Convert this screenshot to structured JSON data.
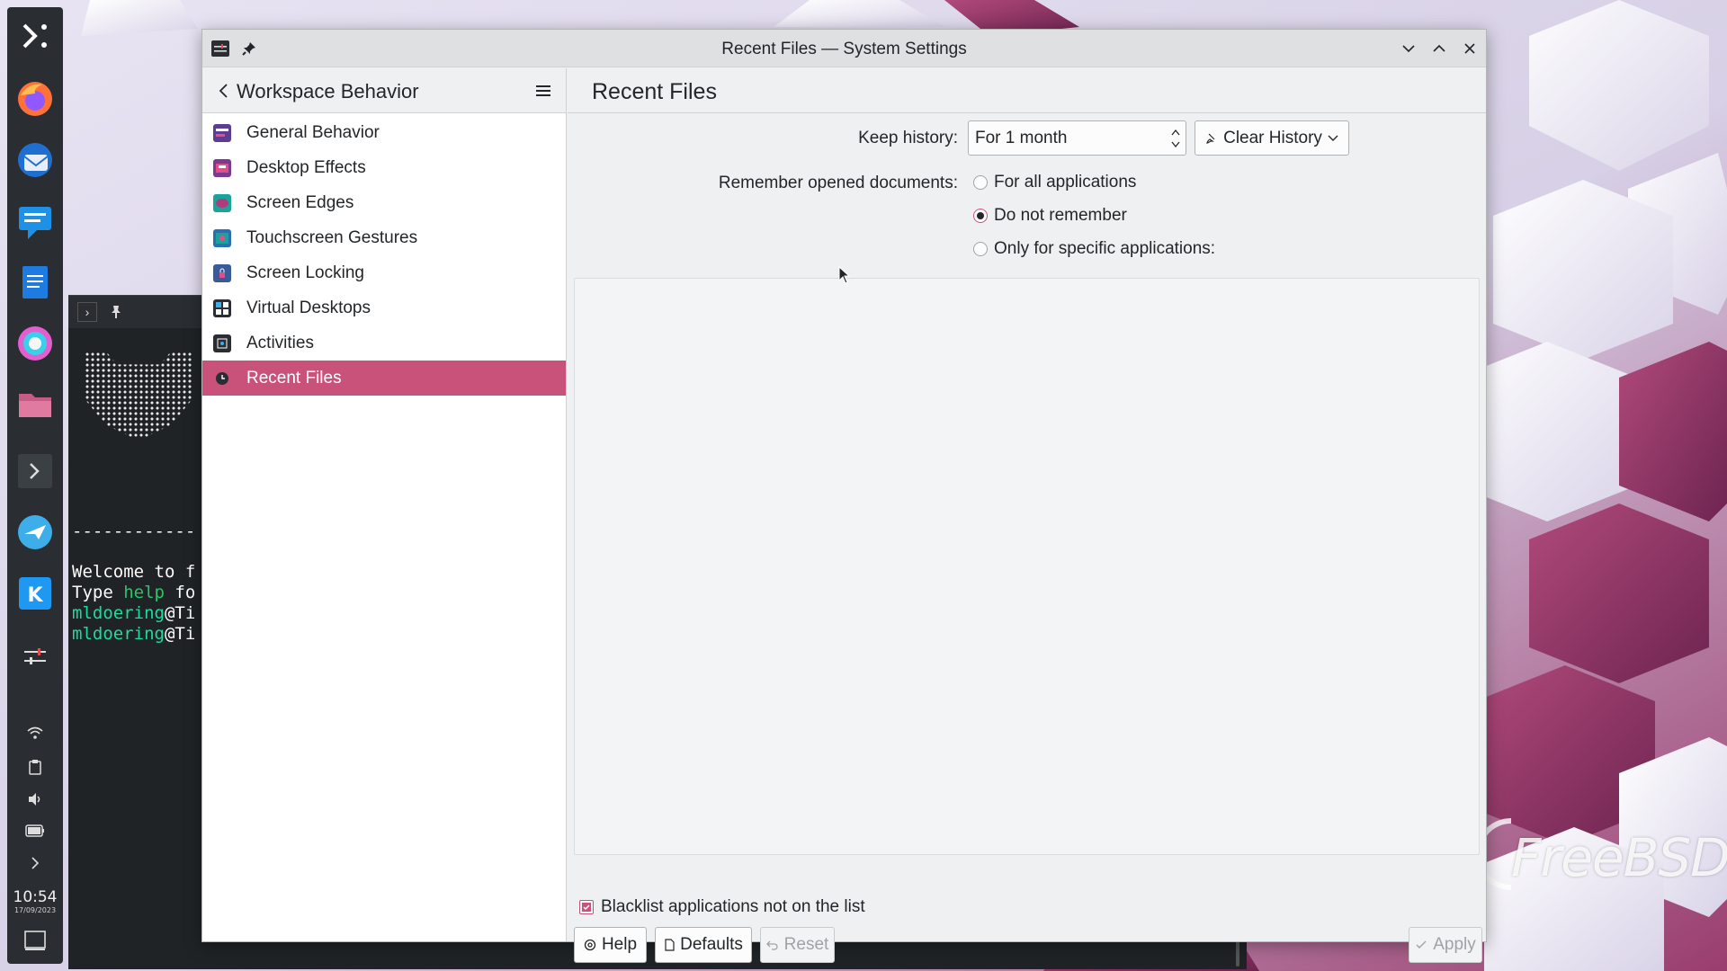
{
  "window": {
    "title": "Recent Files — System Settings",
    "controls": [
      "minimize-icon",
      "maximize-icon",
      "close-icon"
    ]
  },
  "sidebar": {
    "header": "Workspace Behavior",
    "items": [
      {
        "label": "General Behavior",
        "icon": "general-behavior-icon",
        "color": "#5c3d91"
      },
      {
        "label": "Desktop Effects",
        "icon": "desktop-effects-icon",
        "color": "#7a3a8f"
      },
      {
        "label": "Screen Edges",
        "icon": "screen-edges-icon",
        "color": "#1aa39a"
      },
      {
        "label": "Touchscreen Gestures",
        "icon": "touchscreen-gestures-icon",
        "color": "#2a6fb0"
      },
      {
        "label": "Screen Locking",
        "icon": "screen-locking-icon",
        "color": "#3a5b9a"
      },
      {
        "label": "Virtual Desktops",
        "icon": "virtual-desktops-icon",
        "color": "#2a2e32"
      },
      {
        "label": "Activities",
        "icon": "activities-icon",
        "color": "#2a2e32"
      },
      {
        "label": "Recent Files",
        "icon": "recent-files-icon",
        "color": "#2a2e32",
        "active": true
      }
    ]
  },
  "main": {
    "title": "Recent Files",
    "keep_history_label": "Keep history:",
    "keep_history_value": "For 1 month",
    "clear_history_label": "Clear History",
    "remember_label": "Remember opened documents:",
    "radios": [
      {
        "label": "For all applications",
        "checked": false
      },
      {
        "label": "Do not remember",
        "checked": true
      },
      {
        "label": "Only for specific applications:",
        "checked": false
      }
    ],
    "blacklist_label": "Blacklist applications not on the list",
    "blacklist_checked": true
  },
  "footer": {
    "help": "Help",
    "defaults": "Defaults",
    "reset": "Reset",
    "apply": "Apply"
  },
  "panel": {
    "apps": [
      "kde-launcher-icon",
      "firefox-icon",
      "thunderbird-icon",
      "chat-icon",
      "writer-icon",
      "krita-icon",
      "folder-icon",
      "terminal-icon",
      "kdeconnect-icon",
      "kde-icon",
      "settings-icon"
    ],
    "time": "10:54",
    "date": "17/09/2023"
  },
  "terminal": {
    "lines": [
      {
        "prefix": "------------",
        "mid": "",
        "rest": ""
      },
      {
        "prefix": "",
        "mid": "",
        "rest": ""
      },
      {
        "prefix": "Welcome to f",
        "mid": "",
        "rest": ""
      },
      {
        "prefix": "Type ",
        "mid": "help",
        "rest": " fo"
      },
      {
        "user": "mldoering",
        "host": "@Ti"
      },
      {
        "user": "mldoering",
        "host": "@Ti"
      }
    ]
  },
  "wallpaper": {
    "brand": "FreeBSD"
  }
}
